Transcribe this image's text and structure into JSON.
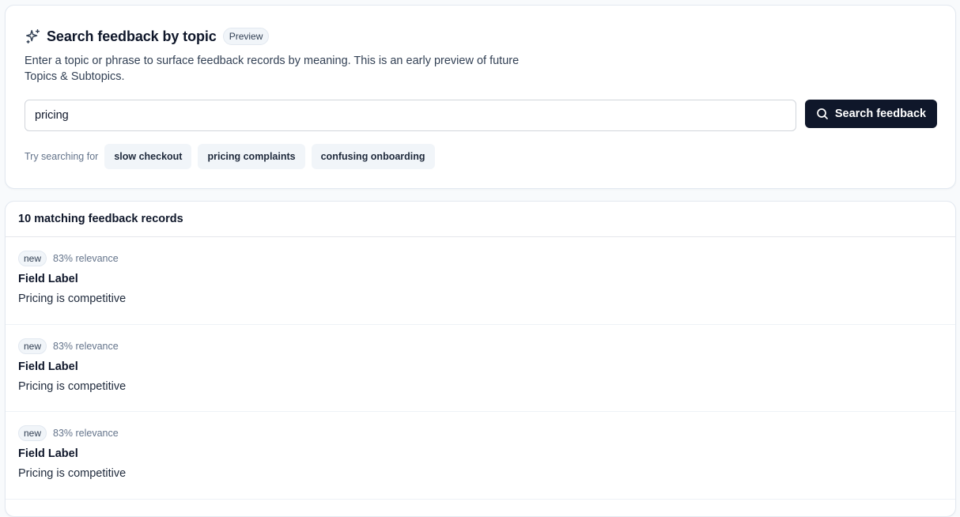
{
  "search": {
    "title": "Search feedback by topic",
    "badge": "Preview",
    "description": "Enter a topic or phrase to surface feedback records by meaning. This is an early preview of future Topics & Subtopics.",
    "query": "pricing",
    "button_label": "Search feedback",
    "suggest_label": "Try searching for",
    "suggestions": [
      "slow checkout",
      "pricing complaints",
      "confusing onboarding"
    ],
    "icons": {
      "title": "sparkles-icon",
      "button": "search-icon"
    }
  },
  "results": {
    "count_label": "10 matching feedback records",
    "records": [
      {
        "status": "new",
        "relevance": "83% relevance",
        "field_label": "Field Label",
        "value": "Pricing is competitive"
      },
      {
        "status": "new",
        "relevance": "83% relevance",
        "field_label": "Field Label",
        "value": "Pricing is competitive"
      },
      {
        "status": "new",
        "relevance": "83% relevance",
        "field_label": "Field Label",
        "value": "Pricing is competitive"
      }
    ]
  },
  "colors": {
    "primary_button": "#0f172a",
    "page_background": "#f8fafc",
    "chip_background": "#f1f5f9"
  }
}
